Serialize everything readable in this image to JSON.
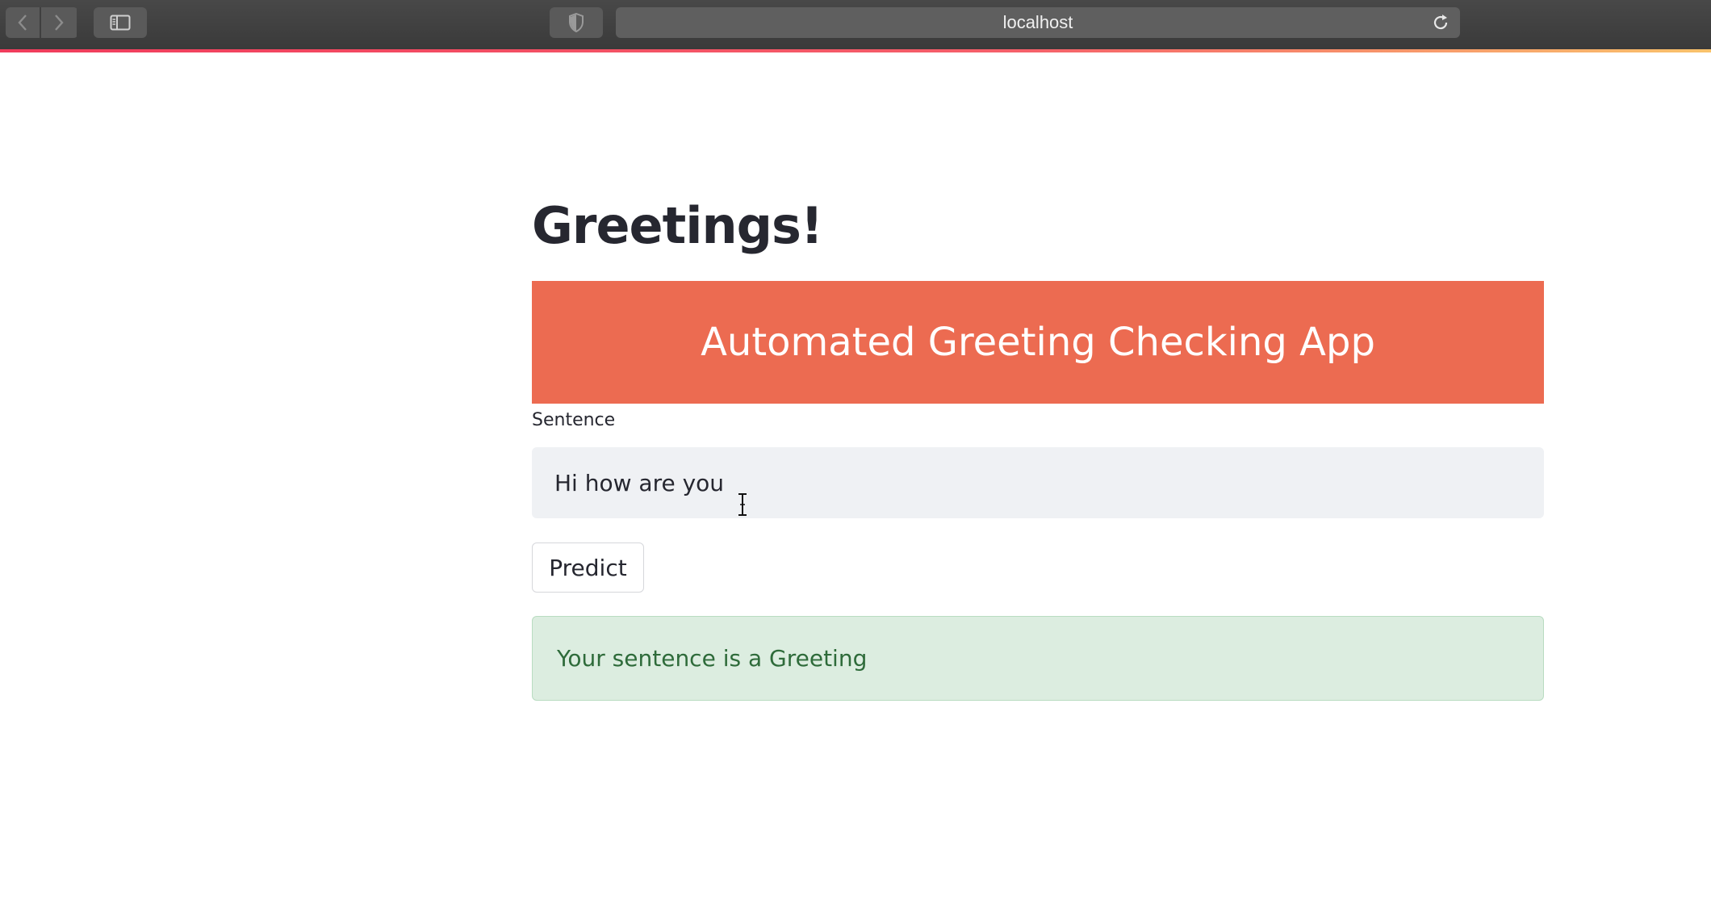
{
  "browser": {
    "url": "localhost",
    "icons": {
      "back": "chevron-left-icon",
      "forward": "chevron-right-icon",
      "sidebar": "sidebar-icon",
      "privacy": "shield-icon",
      "reload": "reload-icon"
    }
  },
  "app": {
    "title": "Greetings!",
    "banner": "Automated Greeting Checking App",
    "banner_color": "#ec6b51",
    "input": {
      "label": "Sentence",
      "value": "Hi how are you"
    },
    "predict_label": "Predict",
    "result": "Your sentence is a Greeting",
    "result_color": "#2e6b3a"
  }
}
